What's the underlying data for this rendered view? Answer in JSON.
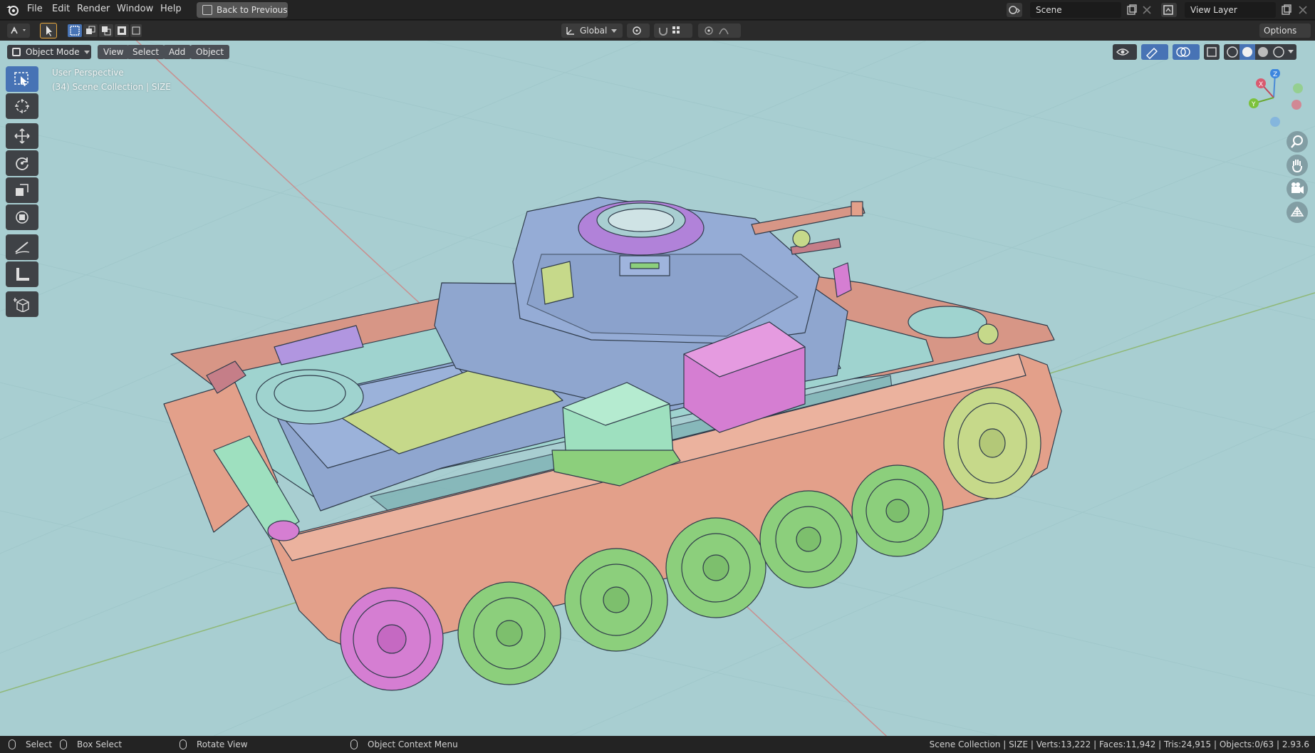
{
  "topbar": {
    "menus": [
      "File",
      "Edit",
      "Render",
      "Window",
      "Help"
    ],
    "back_button": "Back to Previous",
    "scene_value": "Scene",
    "view_layer_value": "View Layer"
  },
  "header": {
    "transform_orientation": "Global",
    "options_label": "Options"
  },
  "viewport": {
    "mode_label": "Object Mode",
    "menus": [
      "View",
      "Select",
      "Add",
      "Object"
    ],
    "perspective_label": "User Perspective",
    "collection_label": "(34) Scene Collection | SIZE",
    "gizmo_axes": [
      "X",
      "Y",
      "Z"
    ]
  },
  "toolbar": {
    "tools": [
      "select-box",
      "cursor",
      "move",
      "rotate",
      "scale",
      "transform",
      "annotate",
      "measure",
      "add-cube"
    ]
  },
  "statusbar": {
    "select_label": "Select",
    "box_select_label": "Box Select",
    "rotate_view_label": "Rotate View",
    "context_menu_label": "Object Context Menu",
    "stats": "Scene Collection | SIZE | Verts:13,222 | Faces:11,942 | Tris:24,915 | Objects:0/63 | 2.93.6"
  },
  "colors": {
    "viewport_bg": "#a8ced1",
    "hull_blue": "#8fa6cf",
    "track_salmon": "#e3a08a",
    "wheel_green": "#8ccf7c",
    "mint": "#9ee0bf",
    "magenta": "#d57ed2",
    "purple": "#b196e0",
    "olive": "#c6d98a",
    "active_tool": "#4773b5"
  }
}
